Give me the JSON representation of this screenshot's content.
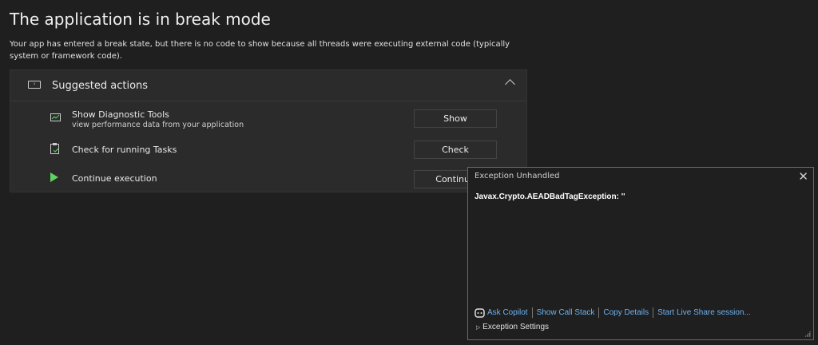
{
  "page": {
    "title": "The application is in break mode",
    "description": "Your app has entered a break state, but there is no code to show because all threads were executing external code (typically system or framework code)."
  },
  "suggested": {
    "header": "Suggested actions",
    "items": [
      {
        "title": "Show Diagnostic Tools",
        "subtitle": "view performance data from your application",
        "button": "Show",
        "icon": "chart-icon"
      },
      {
        "title": "Check for running Tasks",
        "button": "Check",
        "icon": "clipboard-check-icon"
      },
      {
        "title": "Continue execution",
        "button": "Continue",
        "icon": "play-icon"
      }
    ]
  },
  "popup": {
    "header": "Exception Unhandled",
    "exception": "Javax.Crypto.AEADBadTagException: ''",
    "links": [
      "Ask Copilot",
      "Show Call Stack",
      "Copy Details",
      "Start Live Share session..."
    ],
    "settings": "Exception Settings"
  },
  "colors": {
    "play": "#5fd35f",
    "link": "#6cb1f0"
  }
}
